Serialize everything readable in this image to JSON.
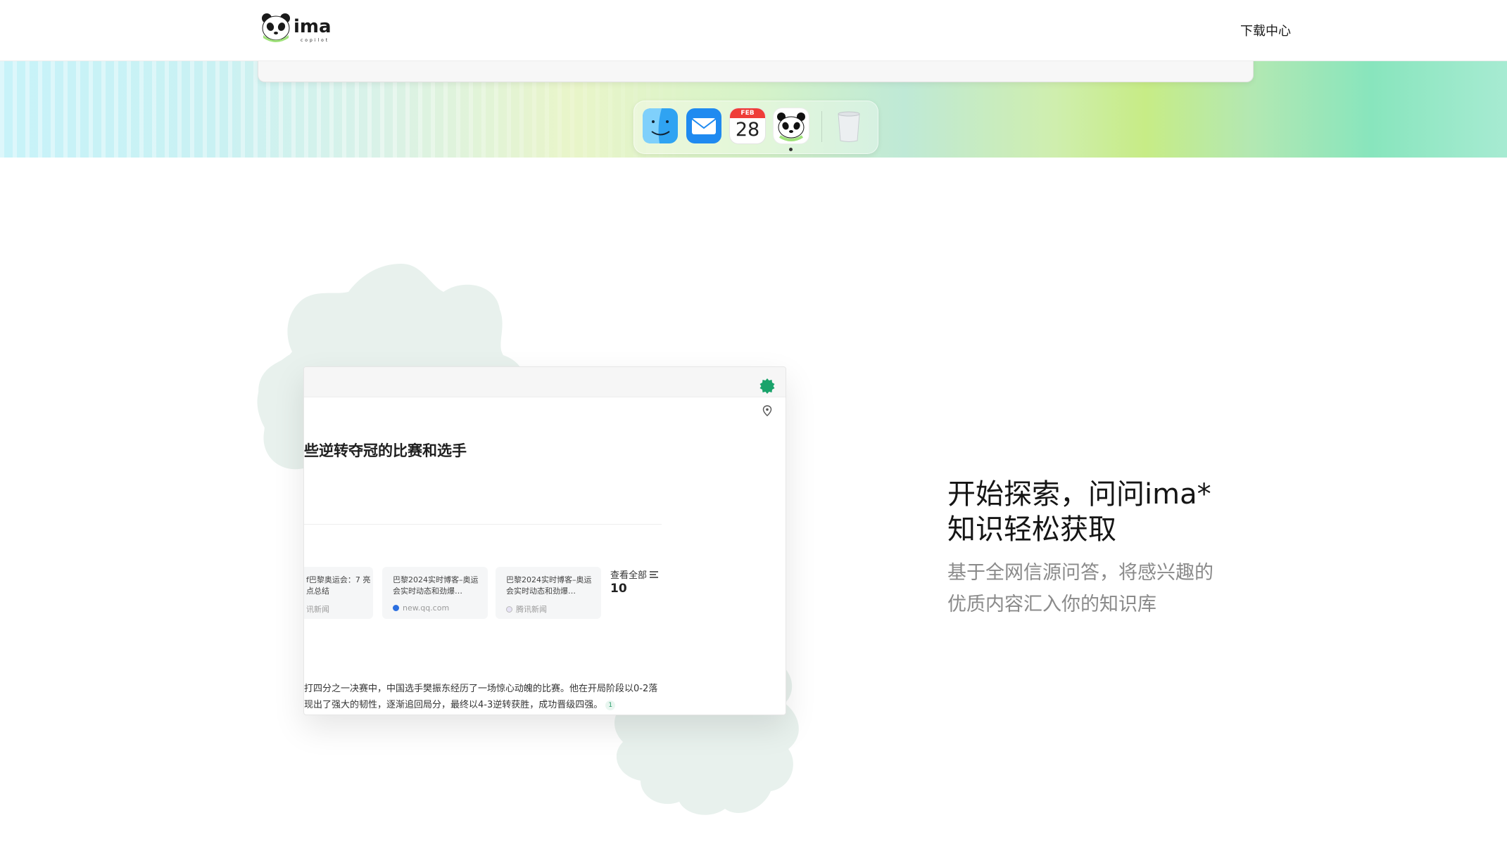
{
  "header": {
    "logo_alt": "ima copilot",
    "logo_text": "ima",
    "logo_subtext": "copilot",
    "download_link": "下载中心"
  },
  "dock": {
    "icons": [
      "finder-icon",
      "mail-icon",
      "calendar-icon",
      "ima-panda-icon",
      "trash-icon"
    ],
    "calendar_month": "FEB",
    "calendar_day": "28"
  },
  "preview": {
    "title": "些逆转夺冠的比赛和选手",
    "sources": [
      {
        "title": "f巴黎奥运会：7 亮点总结",
        "site": "讯新闻"
      },
      {
        "title": "巴黎2024实时博客–奥运会实时动态和劲爆…",
        "site": "new.qq.com"
      },
      {
        "title": "巴黎2024实时博客–奥运会实时动态和劲爆…",
        "site": "腾讯新闻"
      }
    ],
    "view_all_label": "查看全部",
    "view_all_count": "10",
    "body_lines": [
      "打四分之一决赛中，中国选手樊振东经历了一场惊心动魄的比赛。他在开局阶段以0-2落",
      "现出了强大的韧性，逐渐追回局分，最终以4-3逆转获胜，成功晋级四强。"
    ],
    "citation": "1"
  },
  "hero": {
    "heading_line1": "开始探索，问问ima*",
    "heading_line2": "知识轻松获取",
    "sub_line1": "基于全网信源问答，将感兴趣的",
    "sub_line2": "优质内容汇入你的知识库"
  },
  "colors": {
    "brand_green": "#1aa36b",
    "blob": "#e8f2ee",
    "hero_text": "#151515",
    "hero_sub": "#8a8a8a"
  }
}
